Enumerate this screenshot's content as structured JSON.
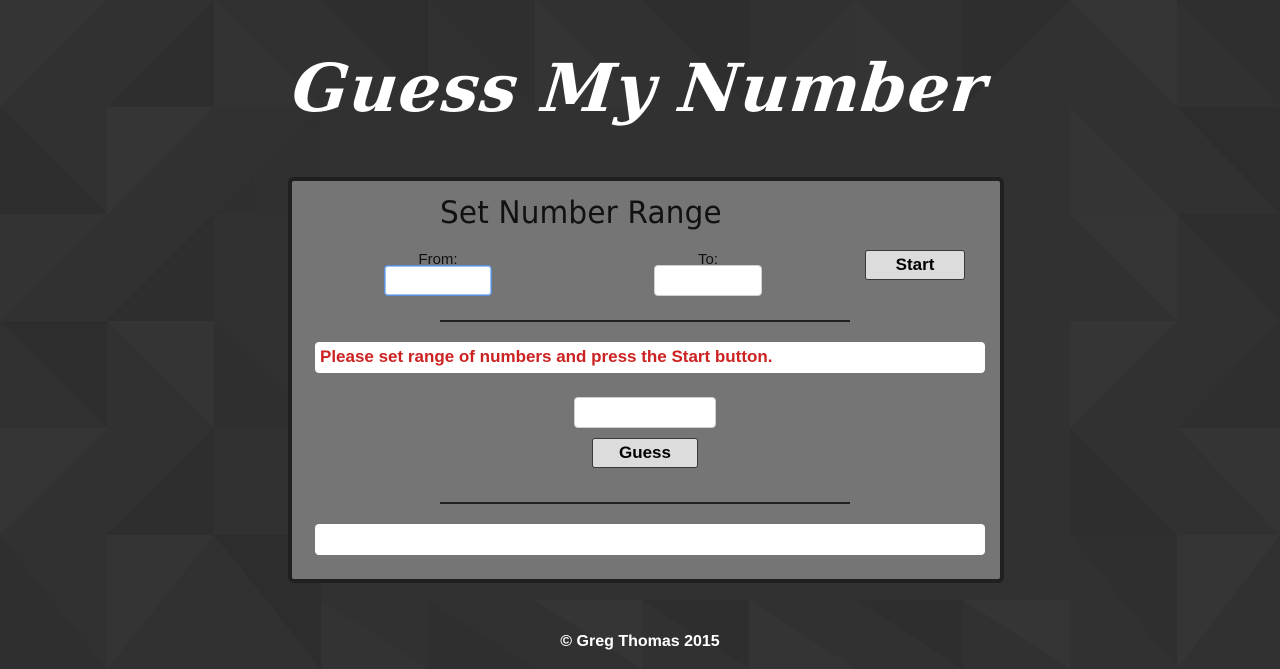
{
  "app": {
    "title": "Guess My Number"
  },
  "range_section": {
    "title": "Set Number Range",
    "from_label": "From:",
    "from_value": "",
    "to_label": "To:",
    "to_value": "",
    "start_label": "Start"
  },
  "status": {
    "message": "Please set range of numbers and press the Start button.",
    "color": "#cc2222"
  },
  "guess": {
    "value": "",
    "button_label": "Guess"
  },
  "result": {
    "message": ""
  },
  "footer": {
    "text": "© Greg Thomas 2015"
  },
  "theme": {
    "background": "#313131",
    "panel": "#757575",
    "panel_border": "#202020",
    "button": "#dcdcdc"
  }
}
